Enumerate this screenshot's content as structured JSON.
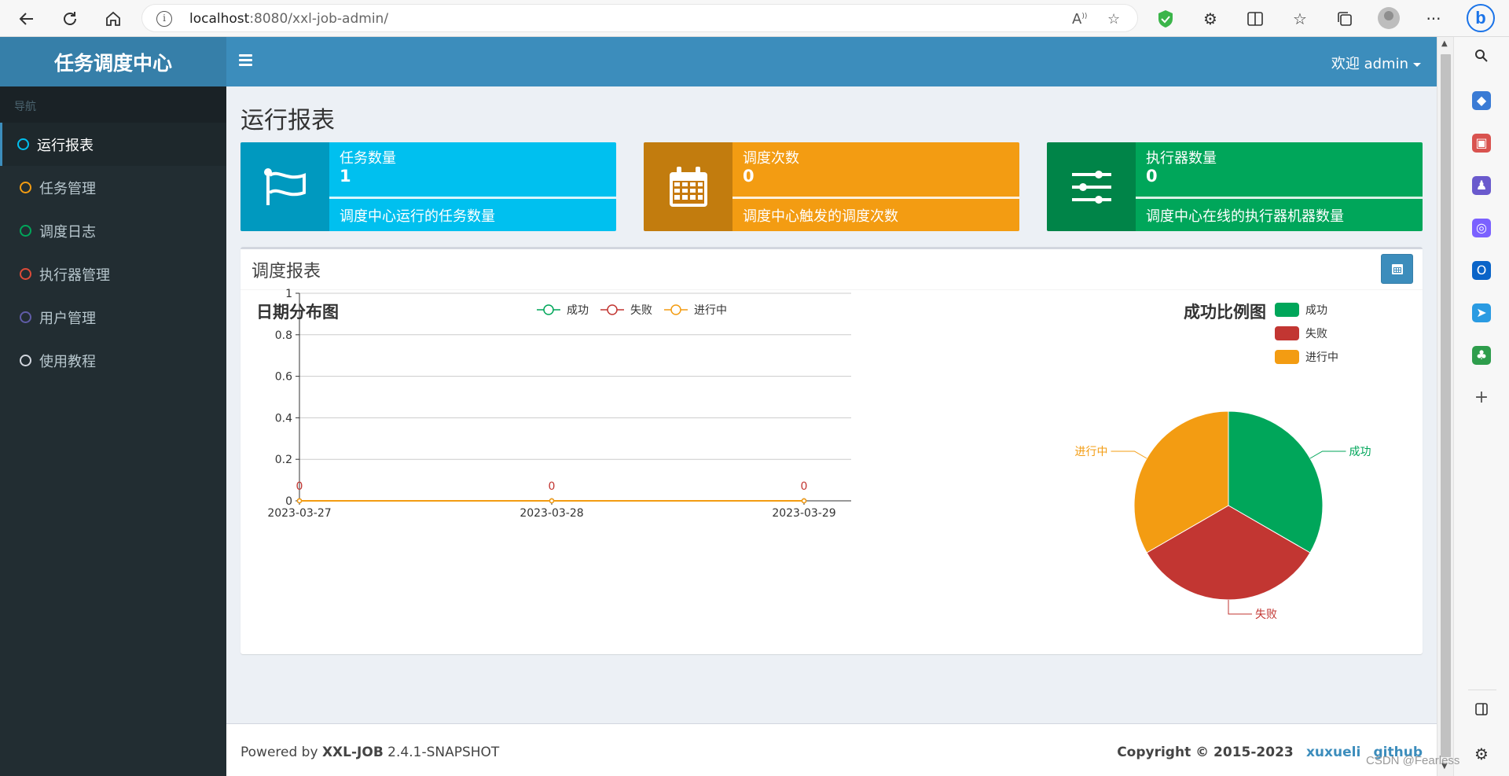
{
  "browser": {
    "url_host": "localhost",
    "url_rest": ":8080/xxl-job-admin/"
  },
  "app": {
    "logo": "任务调度中心",
    "welcome": "欢迎 admin"
  },
  "sidebar": {
    "header": "导航",
    "items": [
      {
        "label": "运行报表",
        "color": "#00c0ef",
        "active": true
      },
      {
        "label": "任务管理",
        "color": "#f39c12",
        "active": false
      },
      {
        "label": "调度日志",
        "color": "#00a65a",
        "active": false
      },
      {
        "label": "执行器管理",
        "color": "#dd4b39",
        "active": false
      },
      {
        "label": "用户管理",
        "color": "#605ca8",
        "active": false
      },
      {
        "label": "使用教程",
        "color": "#d2d6de",
        "active": false
      }
    ]
  },
  "page": {
    "title": "运行报表"
  },
  "info_boxes": [
    {
      "label": "任务数量",
      "value": "1",
      "desc": "调度中心运行的任务数量",
      "color": "#00c0ef",
      "icon": "flag-icon"
    },
    {
      "label": "调度次数",
      "value": "0",
      "desc": "调度中心触发的调度次数",
      "color": "#f39c12",
      "icon": "calendar-icon"
    },
    {
      "label": "执行器数量",
      "value": "0",
      "desc": "调度中心在线的执行器机器数量",
      "color": "#00a65a",
      "icon": "sliders-icon"
    }
  ],
  "report": {
    "title": "调度报表"
  },
  "chart_data": [
    {
      "type": "line",
      "title": "日期分布图",
      "x": [
        "2023-03-27",
        "2023-03-28",
        "2023-03-29"
      ],
      "series": [
        {
          "name": "成功",
          "values": [
            0,
            0,
            0
          ],
          "color": "#00a65a"
        },
        {
          "name": "失败",
          "values": [
            0,
            0,
            0
          ],
          "color": "#c23632"
        },
        {
          "name": "进行中",
          "values": [
            0,
            0,
            0
          ],
          "color": "#f39c12"
        }
      ],
      "data_labels": [
        "0",
        "0",
        "0"
      ],
      "ylim": [
        0,
        1
      ],
      "yticks": [
        "0",
        "0.2",
        "0.4",
        "0.6",
        "0.8",
        "1"
      ],
      "grid": true,
      "legend": "top"
    },
    {
      "type": "pie",
      "title": "成功比例图",
      "categories": [
        "成功",
        "失败",
        "进行中"
      ],
      "values": [
        1,
        1,
        1
      ],
      "colors": [
        "#00a65a",
        "#c23632",
        "#f39c12"
      ],
      "legend": "top-left"
    }
  ],
  "footer": {
    "powered_prefix": "Powered by ",
    "product": "XXL-JOB",
    "version": " 2.4.1-SNAPSHOT",
    "copyright": "Copyright © 2015-2023",
    "link1": "xuxueli",
    "link2": "github"
  },
  "watermark": "CSDN @Fearless"
}
